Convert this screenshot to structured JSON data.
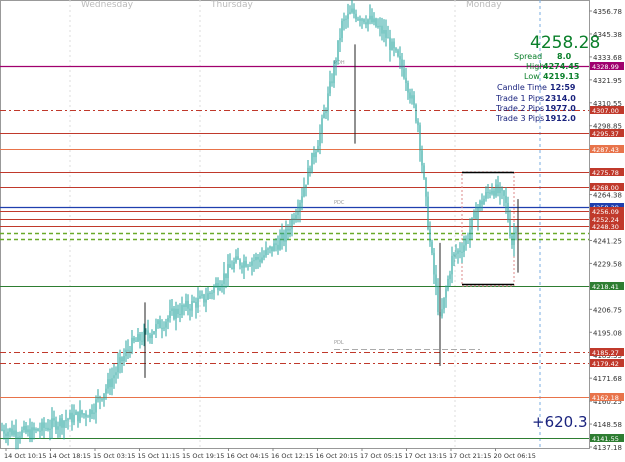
{
  "day_labels": [
    "Wednesday",
    "Thursday",
    "Monday"
  ],
  "info_panel": {
    "price": "4258.28",
    "spread_label": "Spread",
    "spread_value": "8.0",
    "high_label": "High",
    "high_value": "4274.45",
    "low_label": "Low",
    "low_value": "4219.13",
    "candle_time_label": "Candle Time",
    "candle_time_value": "12:59",
    "trade1_label": "Trade 1 Pips",
    "trade1_value": "2314.0",
    "trade2_label": "Trade 2 Pips",
    "trade2_value": "1977.0",
    "trade3_label": "Trade 3 Pips",
    "trade3_value": "1912.0"
  },
  "profit_label": "+620.3",
  "chart_markers": {
    "pdh": "PDH",
    "pdc": "PDC",
    "pdl": "PDL"
  },
  "chart_data": {
    "type": "candlestick",
    "ylim": [
      4137.18,
      4356.78
    ],
    "price_ticks": [
      "4356.78",
      "4345.38",
      "4333.68",
      "4321.95",
      "4310.55",
      "4298.85",
      "4287.43",
      "4275.78",
      "4264.38",
      "4252.95",
      "4241.25",
      "4229.58",
      "4218.41",
      "4206.75",
      "4195.08",
      "4183.35",
      "4171.68",
      "4160.25",
      "4148.58",
      "4137.18"
    ],
    "time_ticks": [
      "14 Oct 10:15",
      "14 Oct 18:15",
      "15 Oct 03:15",
      "15 Oct 11:15",
      "15 Oct 19:15",
      "16 Oct 04:15",
      "16 Oct 12:15",
      "16 Oct 20:15",
      "17 Oct 05:15",
      "17 Oct 13:15",
      "17 Oct 21:15",
      "20 Oct 06:15"
    ],
    "current_price": 4258.28,
    "levels": [
      {
        "price": 4328.99,
        "label": "4328.99",
        "color": "#a0006e"
      },
      {
        "price": 4307.0,
        "label": "4307.00",
        "color": "#c0392b"
      },
      {
        "price": 4295.37,
        "label": "4295.37",
        "color": "#c0392b"
      },
      {
        "price": 4287.43,
        "label": "4287.43",
        "color": "#e8734a"
      },
      {
        "price": 4275.78,
        "label": "4275.78",
        "color": "#c0392b"
      },
      {
        "price": 4268.0,
        "label": "4268.00",
        "color": "#c0392b"
      },
      {
        "price": 4258.28,
        "label": "4258.28",
        "color": "#1f3fae"
      },
      {
        "price": 4256.09,
        "label": "4256.09",
        "color": "#c0392b"
      },
      {
        "price": 4252.24,
        "label": "4252.24",
        "color": "#c0392b"
      },
      {
        "price": 4248.3,
        "label": "4248.30",
        "color": "#c0392b"
      },
      {
        "price": 4218.41,
        "label": "4218.41",
        "color": "#2e7d32"
      },
      {
        "price": 4185.27,
        "label": "4185.27",
        "color": "#c0392b"
      },
      {
        "price": 4179.42,
        "label": "4179.42",
        "color": "#c0392b"
      },
      {
        "price": 4162.18,
        "label": "4162.18",
        "color": "#e8734a"
      },
      {
        "price": 4141.55,
        "label": "4141.55",
        "color": "#2e7d32"
      }
    ]
  },
  "colors": {
    "candle": "#2aa6a0",
    "green_dash": "#6aaa2a",
    "axis_bg": "#ffffff"
  }
}
